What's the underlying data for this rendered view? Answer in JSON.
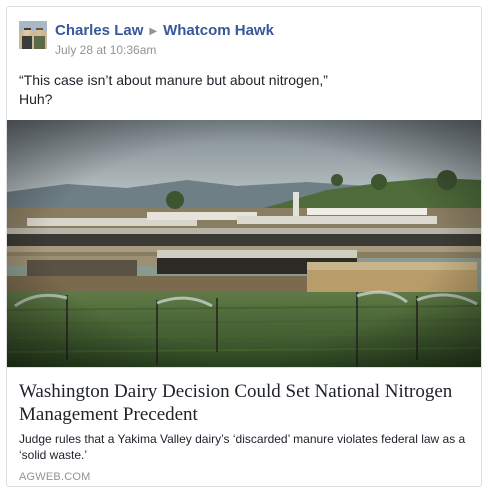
{
  "post": {
    "author": "Charles Law",
    "target_page": "Whatcom Hawk",
    "timestamp": "July 28 at 10:36am",
    "message_lines": [
      "“This case isn’t about manure but about nitrogen,”",
      "Huh?"
    ]
  },
  "link_preview": {
    "title": "Washington Dairy Decision Could Set National Nitrogen Management Precedent",
    "description": "Judge rules that a Yakima Valley dairy’s ‘discarded’ manure violates federal law as a ‘solid waste.’",
    "domain": "AGWEB.COM",
    "image_subject": "dairy-farm-with-sprinklers-photo"
  },
  "colors": {
    "link_blue": "#365899",
    "meta_gray": "#90949c",
    "text": "#1d2129",
    "border": "#dddfe2"
  },
  "icons": {
    "separator": "right-triangle-icon"
  }
}
